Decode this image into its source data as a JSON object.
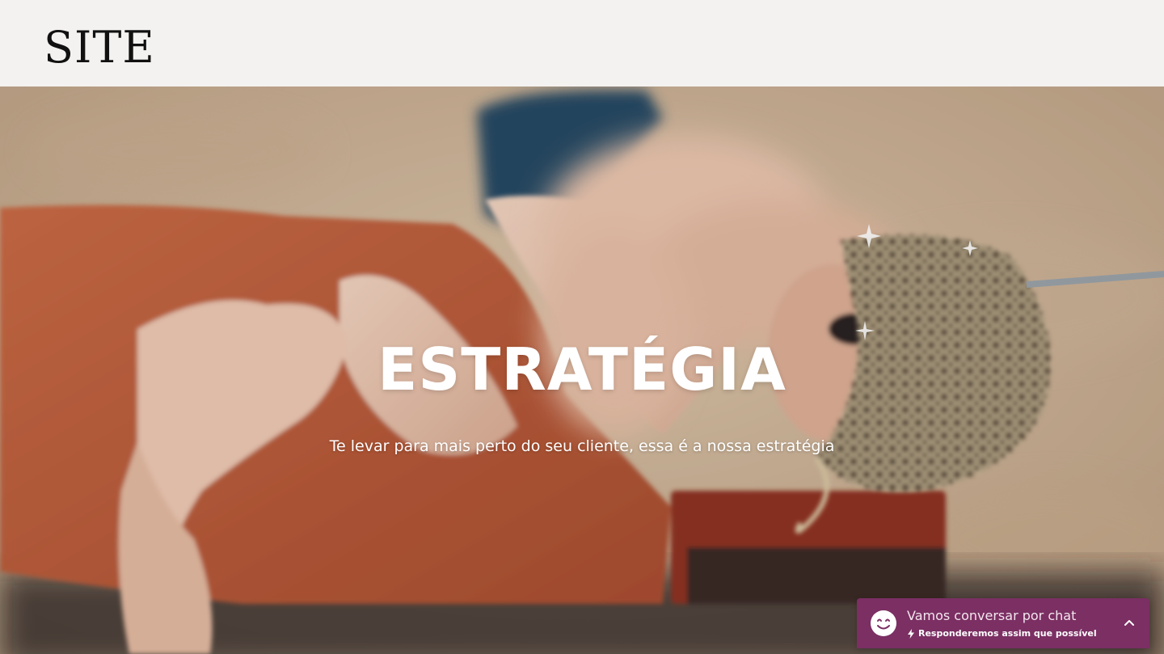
{
  "header": {
    "logo": "SITE"
  },
  "hero": {
    "title": "ESTRATÉGIA",
    "subtitle": "Te levar para mais perto do seu cliente, essa é a nossa estratégia",
    "image_icon": "hero-photo"
  },
  "chat": {
    "title": "Vamos conversar por chat",
    "subtitle": "Responderemos assim que possível",
    "avatar_icon": "smiley-icon",
    "bolt_icon": "lightning-icon",
    "toggle_icon": "chevron-up-icon",
    "color": "#7b2f63"
  }
}
